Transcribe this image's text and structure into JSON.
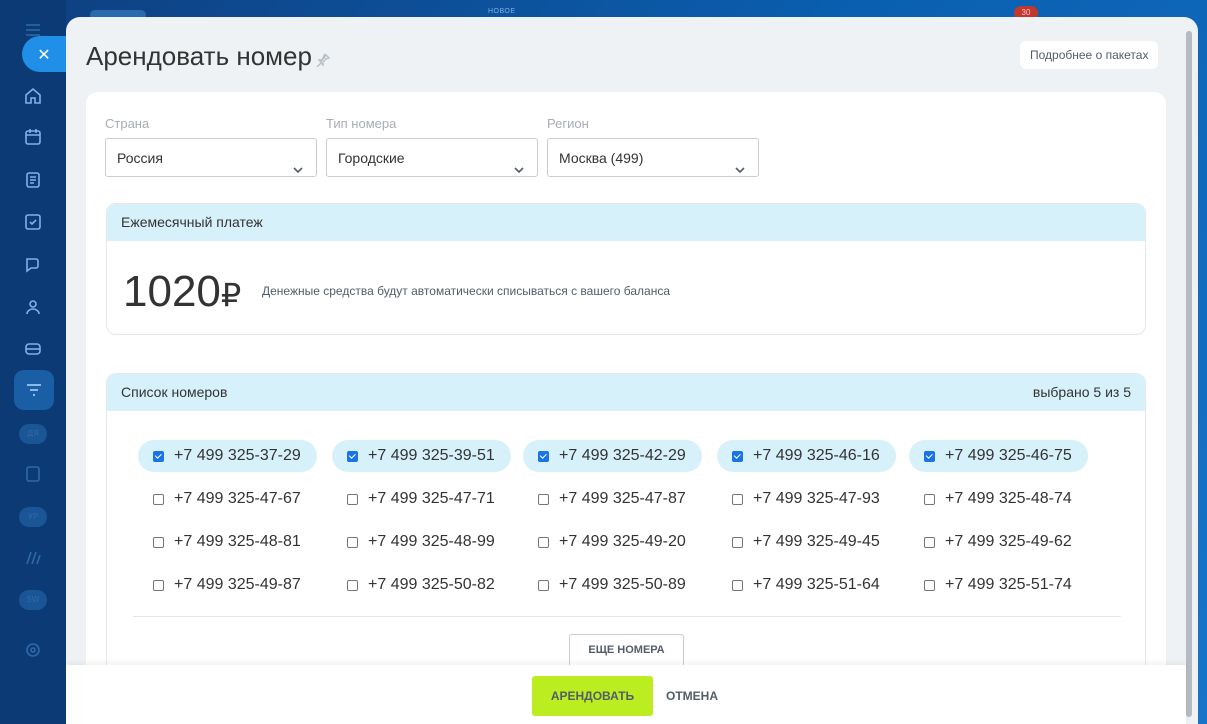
{
  "topbar": {
    "strip_text": "НОВОЕ",
    "notification_count": "30"
  },
  "slider": {
    "title": "Арендовать номер",
    "more_packages": "Подробнее о пакетах"
  },
  "filters": [
    {
      "label": "Страна",
      "value": "Россия"
    },
    {
      "label": "Тип номера",
      "value": "Городские"
    },
    {
      "label": "Регион",
      "value": "Москва (499)"
    }
  ],
  "payment": {
    "heading": "Ежемесячный платеж",
    "amount": "1020",
    "currency": "₽",
    "note": "Денежные средства будут автоматически списываться с вашего баланса"
  },
  "numbers": {
    "heading": "Список номеров",
    "selected_counter": "выбрано 5 из 5",
    "rows": [
      [
        {
          "number": "+7 499 325-37-29",
          "checked": true
        },
        {
          "number": "+7 499 325-39-51",
          "checked": true
        },
        {
          "number": "+7 499 325-42-29",
          "checked": true
        },
        {
          "number": "+7 499 325-46-16",
          "checked": true
        },
        {
          "number": "+7 499 325-46-75",
          "checked": true
        }
      ],
      [
        {
          "number": "+7 499 325-47-67",
          "checked": false
        },
        {
          "number": "+7 499 325-47-71",
          "checked": false
        },
        {
          "number": "+7 499 325-47-87",
          "checked": false
        },
        {
          "number": "+7 499 325-47-93",
          "checked": false
        },
        {
          "number": "+7 499 325-48-74",
          "checked": false
        }
      ],
      [
        {
          "number": "+7 499 325-48-81",
          "checked": false
        },
        {
          "number": "+7 499 325-48-99",
          "checked": false
        },
        {
          "number": "+7 499 325-49-20",
          "checked": false
        },
        {
          "number": "+7 499 325-49-45",
          "checked": false
        },
        {
          "number": "+7 499 325-49-62",
          "checked": false
        }
      ],
      [
        {
          "number": "+7 499 325-49-87",
          "checked": false
        },
        {
          "number": "+7 499 325-50-82",
          "checked": false
        },
        {
          "number": "+7 499 325-50-89",
          "checked": false
        },
        {
          "number": "+7 499 325-51-64",
          "checked": false
        },
        {
          "number": "+7 499 325-51-74",
          "checked": false
        }
      ]
    ],
    "more_button": "ЕЩЕ НОМЕРА"
  },
  "footer": {
    "rent_button": "АРЕНДОВАТЬ",
    "cancel_button": "ОТМЕНА"
  },
  "colors": {
    "accent": "#1f8fe8",
    "rent": "#bbed21",
    "section_header": "#d7f1fb",
    "checkbox": "#1b73e8"
  },
  "sidebar_icons": [
    "menu-icon",
    "home-icon",
    "calendar-icon",
    "document-icon",
    "tasks-icon",
    "chat-icon",
    "contacts-icon",
    "inbox-icon",
    "filter-icon",
    "page-icon",
    "stack-icon",
    "settings-icon"
  ],
  "sidebar_badges": [
    "ДЯ",
    "УР",
    "SW"
  ]
}
